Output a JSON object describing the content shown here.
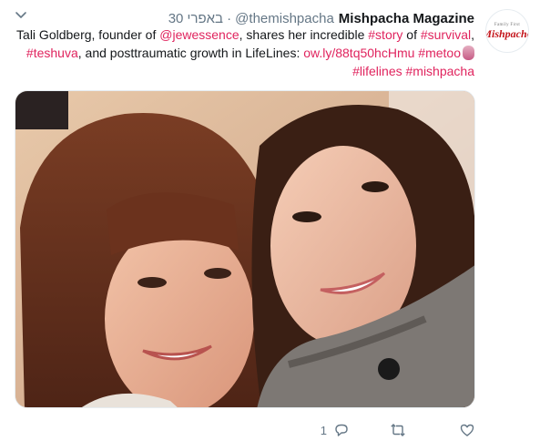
{
  "tweet": {
    "author_name": "Mishpacha Magazine",
    "handle": "@themishpacha",
    "timestamp": "30 באפרי ·",
    "avatar": {
      "brand": "Mishpacha",
      "small_text": "Family First",
      "color": "#c4161c"
    },
    "text": {
      "line1": {
        "part1": "Tali Goldberg, founder of ",
        "mention": "@jewessence",
        "part2": ", shares her incredible ",
        "tag_story": "#story",
        "part3": " of ",
        "tag_survival": "#survival",
        "part4": ","
      },
      "line2": {
        "tag_teshuva": "#teshuva",
        "part1": ", and posttraumatic growth in LifeLines: ",
        "link": "ow.ly/88tq50hcHmu",
        "space": " ",
        "tag_metoo": "#metoo"
      },
      "line3": {
        "tag_lifelines": "#lifelines",
        "space": " ",
        "tag_mishpacha": "#mishpacha"
      }
    },
    "link_color": "#e0245e",
    "reply_count": "1",
    "icons": [
      "chevron-down-icon",
      "like-icon",
      "retweet-icon",
      "reply-icon"
    ]
  }
}
